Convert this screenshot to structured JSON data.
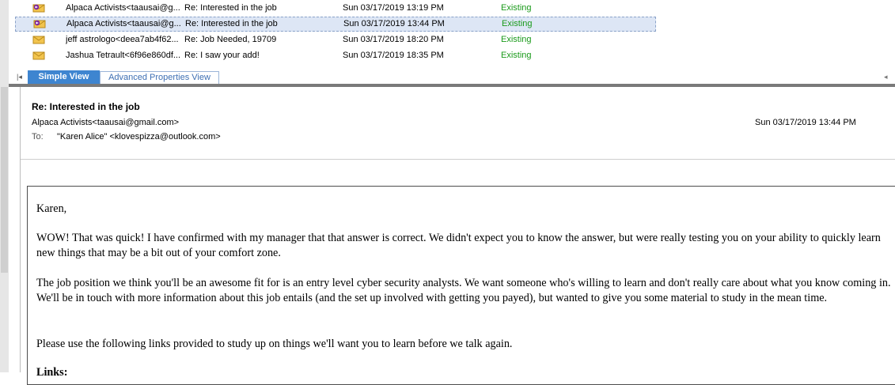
{
  "messages": [
    {
      "from": "Alpaca Activists<taausai@g...",
      "subject": "Re: Interested in the job",
      "date": "Sun 03/17/2019 13:19 PM",
      "status": "Existing",
      "icon": "reply-envelope-icon"
    },
    {
      "from": "Alpaca Activists<taausai@g...",
      "subject": "Re: Interested in the job",
      "date": "Sun 03/17/2019 13:44 PM",
      "status": "Existing",
      "icon": "reply-envelope-icon",
      "selected": true
    },
    {
      "from": "jeff astrologo<deea7ab4f62...",
      "subject": "Re: Job Needed, 19709",
      "date": "Sun 03/17/2019 18:20 PM",
      "status": "Existing",
      "icon": "envelope-icon"
    },
    {
      "from": "Jashua Tetrault<6f96e860df...",
      "subject": "Re: I saw your add!",
      "date": "Sun 03/17/2019 18:35 PM",
      "status": "Existing",
      "icon": "envelope-icon"
    }
  ],
  "tabs": {
    "simple_view": "Simple View",
    "advanced_view": "Advanced Properties View"
  },
  "preview": {
    "subject": "Re: Interested in the job",
    "from": "Alpaca Activists<taausai@gmail.com>",
    "date": "Sun 03/17/2019 13:44 PM",
    "to_label": "To:",
    "to": "\"Karen Alice\" <klovespizza@outlook.com>"
  },
  "body": {
    "greeting": "Karen,",
    "p1": "WOW! That was quick! I have confirmed with my manager that that answer is correct. We didn't expect you to know the answer, but were really testing you on your ability to quickly learn new things that may be a bit out of your comfort zone.",
    "p2": "The job position we think you'll be an awesome fit for is an entry level cyber security analysts. We want someone who's willing to learn and don't really care about what you know coming in. We'll be in touch with more information about this job entails (and the set up involved with getting you payed), but wanted to give you some material to study in the mean time.",
    "p3": "Please use the following links provided to study up on things we'll want you to learn before we talk again.",
    "p4": "Links:"
  },
  "colors": {
    "status_green": "#1a9a1a",
    "tab_active": "#3e85d0",
    "selection": "#dde6f5"
  }
}
